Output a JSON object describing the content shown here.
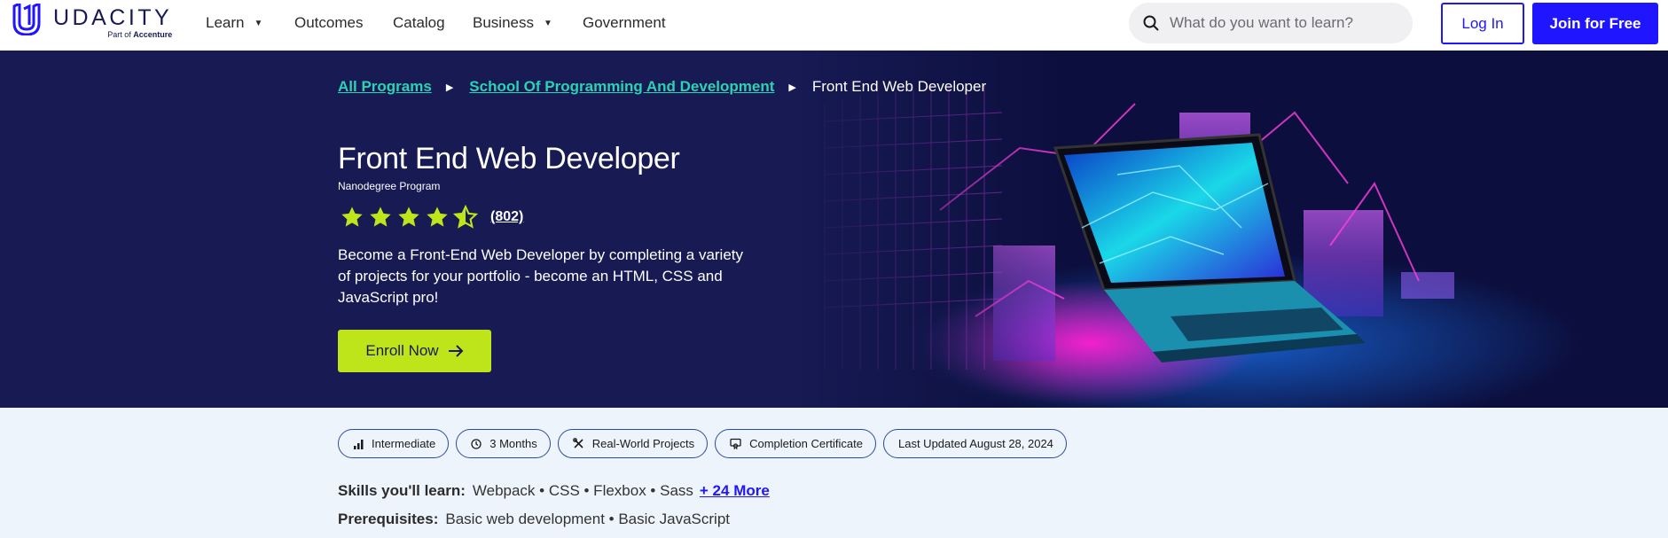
{
  "nav": {
    "logo_word": "UDACITY",
    "logo_sub_prefix": "Part of",
    "logo_sub_brand": "Accenture",
    "links": [
      {
        "label": "Learn"
      },
      {
        "label": "Outcomes"
      },
      {
        "label": "Catalog"
      },
      {
        "label": "Business"
      },
      {
        "label": "Government"
      }
    ],
    "search_placeholder": "What do you want to learn?",
    "login_label": "Log In",
    "join_label": "Join for Free"
  },
  "hero": {
    "breadcrumb": [
      {
        "label": "All Programs"
      },
      {
        "label": "School Of Programming And Development"
      },
      {
        "label": "Front End Web Developer"
      }
    ],
    "title": "Front End Web Developer",
    "subtitle": "Nanodegree Program",
    "rating": 4.5,
    "rating_max": 5,
    "rating_count": "(802)",
    "description": "Become a Front-End Web Developer by completing a variety of projects for your portfolio - become an HTML, CSS and JavaScript pro!",
    "enroll_label": "Enroll Now"
  },
  "info": {
    "chips": [
      {
        "label": "Intermediate",
        "icon": "bar-chart-icon"
      },
      {
        "label": "3 Months",
        "icon": "clock-icon"
      },
      {
        "label": "Real-World Projects",
        "icon": "tools-icon"
      },
      {
        "label": "Completion Certificate",
        "icon": "certificate-icon"
      },
      {
        "label": "Last Updated August 28, 2024",
        "icon": ""
      }
    ],
    "skills_label": "Skills you'll learn:",
    "skills": "Webpack • CSS • Flexbox • Sass",
    "skills_more": "+ 24 More",
    "prereq_label": "Prerequisites:",
    "prereqs": "Basic web development • Basic JavaScript"
  },
  "colors": {
    "brand_blue": "#2015ff",
    "hero_bg": "#171a53",
    "accent_green": "#bde51a",
    "link_teal": "#2bd3b2"
  }
}
